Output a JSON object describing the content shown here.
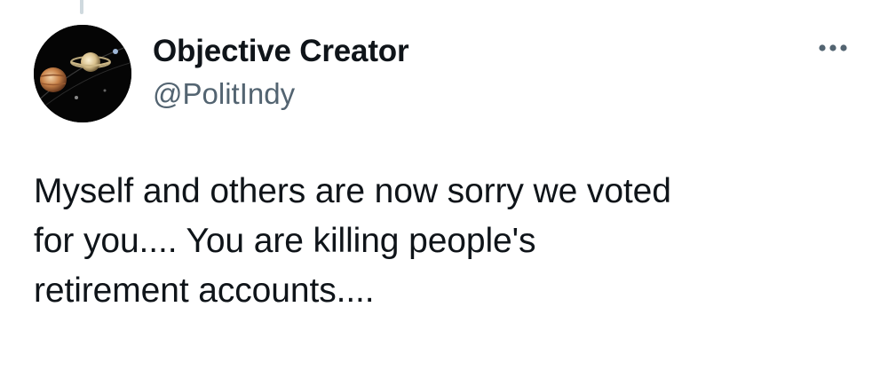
{
  "author": {
    "display_name": "Objective Creator",
    "handle": "@PolitIndy",
    "avatar_icon": "planets-avatar-icon"
  },
  "tweet": {
    "lines": [
      "Myself and others are now sorry we voted",
      "for you.... You are killing people's",
      "retirement accounts...."
    ]
  },
  "actions": {
    "more_icon": "more-options-icon"
  },
  "colors": {
    "text_primary": "#0f1419",
    "text_secondary": "#536471",
    "thread_line": "#cfd9de"
  }
}
